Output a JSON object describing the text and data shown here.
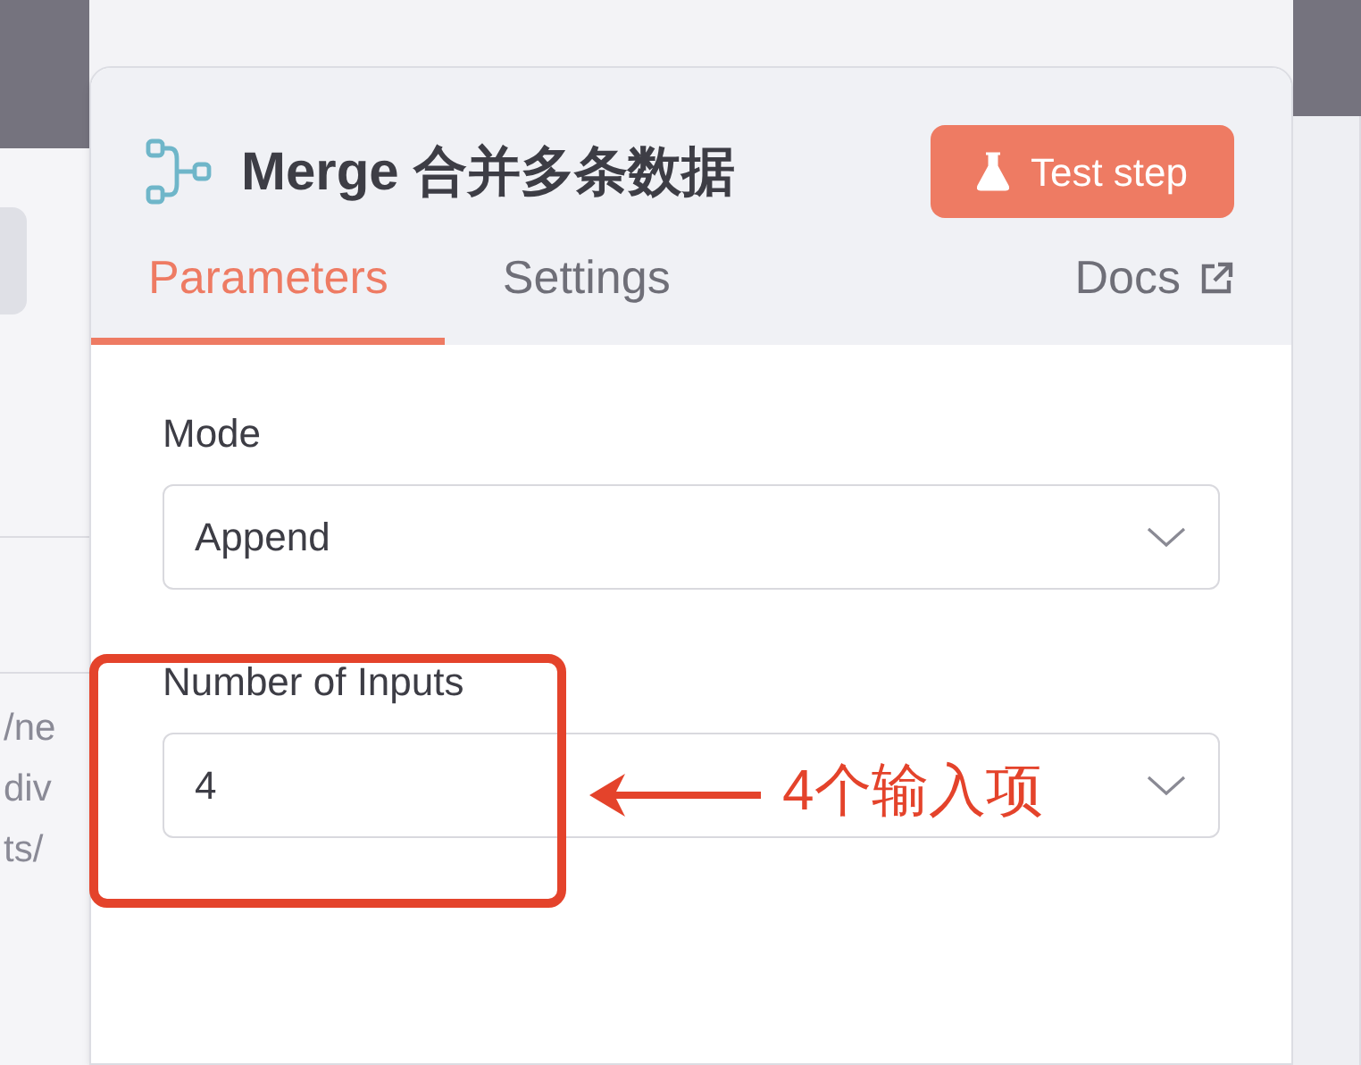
{
  "node": {
    "title": "Merge 合并多条数据",
    "test_button": "Test step"
  },
  "tabs": [
    {
      "label": "Parameters",
      "selected": true,
      "kind": "tab"
    },
    {
      "label": "Settings",
      "selected": false,
      "kind": "tab"
    },
    {
      "label": "Docs",
      "selected": false,
      "kind": "link"
    }
  ],
  "fields": [
    {
      "label": "Mode",
      "value": "Append"
    },
    {
      "label": "Number of Inputs",
      "value": "4"
    }
  ],
  "annotation": {
    "text": "4个输入项"
  },
  "background_text": [
    "/ne",
    "div",
    "ts/"
  ]
}
